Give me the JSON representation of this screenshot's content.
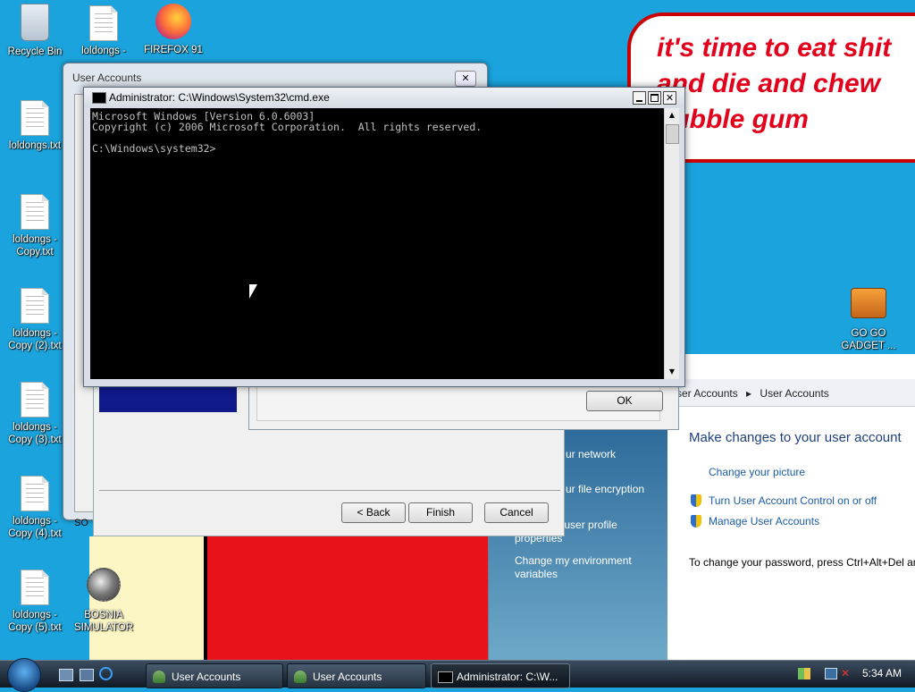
{
  "desktop_icons": [
    {
      "label": "Recycle Bin",
      "icon": "recycle-bin-icon"
    },
    {
      "label": "loldongs -",
      "icon": "text-file-icon"
    },
    {
      "label": "FIREFOX 91",
      "icon": "firefox-icon"
    },
    {
      "label": "loldongs.txt",
      "icon": "text-file-icon"
    },
    {
      "label": "loldongs - Copy.txt",
      "icon": "text-file-icon"
    },
    {
      "label": "loldongs - Copy (2).txt",
      "icon": "text-file-icon"
    },
    {
      "label": "loldongs - Copy (3).txt",
      "icon": "text-file-icon"
    },
    {
      "label": "loldongs - Copy (4).txt",
      "icon": "text-file-icon"
    },
    {
      "label": "loldongs - Copy (5).txt",
      "icon": "text-file-icon"
    },
    {
      "label": "BOSNIA SIMULATOR",
      "icon": "mine-icon"
    },
    {
      "label": "GO GO GADGET ...",
      "icon": "briefcase-icon"
    }
  ],
  "wallpaper": {
    "speech_bubble_lines": [
      "it's time to eat shit",
      "and die and chew",
      "bubble gum"
    ]
  },
  "user_accounts_dialog": {
    "title": "User Accounts",
    "close_glyph": "✕",
    "ok_label": "OK"
  },
  "wizard": {
    "back_label": "< Back",
    "finish_label": "Finish",
    "cancel_label": "Cancel",
    "partial_label": "SO"
  },
  "cmd": {
    "title": "Administrator: C:\\Windows\\System32\\cmd.exe",
    "lines": [
      "Microsoft Windows [Version 6.0.6003]",
      "Copyright (c) 2006 Microsoft Corporation.  All rights reserved.",
      "",
      "C:\\Windows\\system32>"
    ]
  },
  "control_panel": {
    "breadcrumb": [
      "ser Accounts",
      "User Accounts"
    ],
    "heading": "Make changes to your user account",
    "links": [
      {
        "label": "Change your picture",
        "shield": false
      },
      {
        "label": "Turn User Account Control on or off",
        "shield": true
      },
      {
        "label": "Manage User Accounts",
        "shield": true
      }
    ],
    "password_note": "To change your password, press Ctrl+Alt+Del an",
    "side_links": [
      "ur network",
      "ur file encryption",
      "advanced user profile properties",
      "Change my environment variables"
    ]
  },
  "taskbar": {
    "buttons": [
      {
        "label": "User Accounts",
        "icon": "user-accounts-icon"
      },
      {
        "label": "User Accounts",
        "icon": "user-accounts-icon"
      },
      {
        "label": "Administrator: C:\\W...",
        "icon": "cmd-icon"
      }
    ],
    "clock": "5:34 AM"
  },
  "colors": {
    "desktop": "#1aa3dc",
    "cmd_bg": "#000000",
    "taskbar": "#1c2a3a",
    "link": "#1a5ba8"
  }
}
